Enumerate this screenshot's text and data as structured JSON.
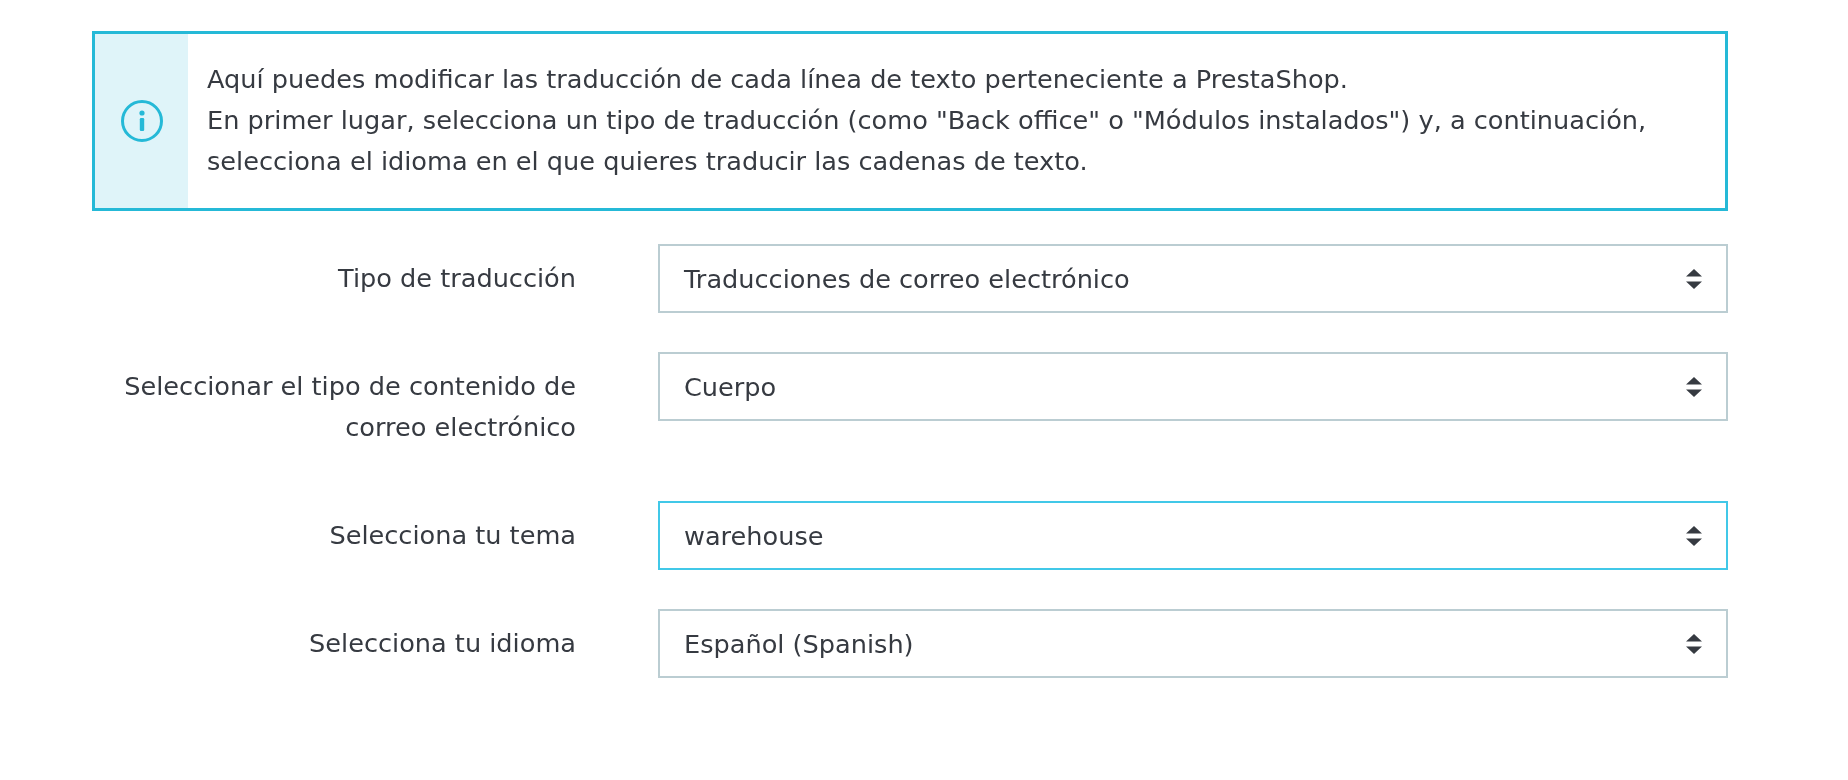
{
  "alert": {
    "paragraphs": [
      "Aquí puedes modificar las traducción de cada línea de texto perteneciente a PrestaShop.",
      "En primer lugar, selecciona un tipo de traducción (como \"Back office\" o \"Módulos instalados\") y, a continuación, selecciona el idioma en el que quieres traducir las cadenas de texto."
    ]
  },
  "fields": [
    {
      "label": "Tipo de traducción",
      "value": "Traducciones de correo electrónico",
      "focused": false
    },
    {
      "label": "Seleccionar el tipo de contenido de correo electrónico",
      "value": "Cuerpo",
      "focused": false
    },
    {
      "label": "Selecciona tu tema",
      "value": "warehouse",
      "focused": true
    },
    {
      "label": "Selecciona tu idioma",
      "value": "Español (Spanish)",
      "focused": false
    }
  ]
}
